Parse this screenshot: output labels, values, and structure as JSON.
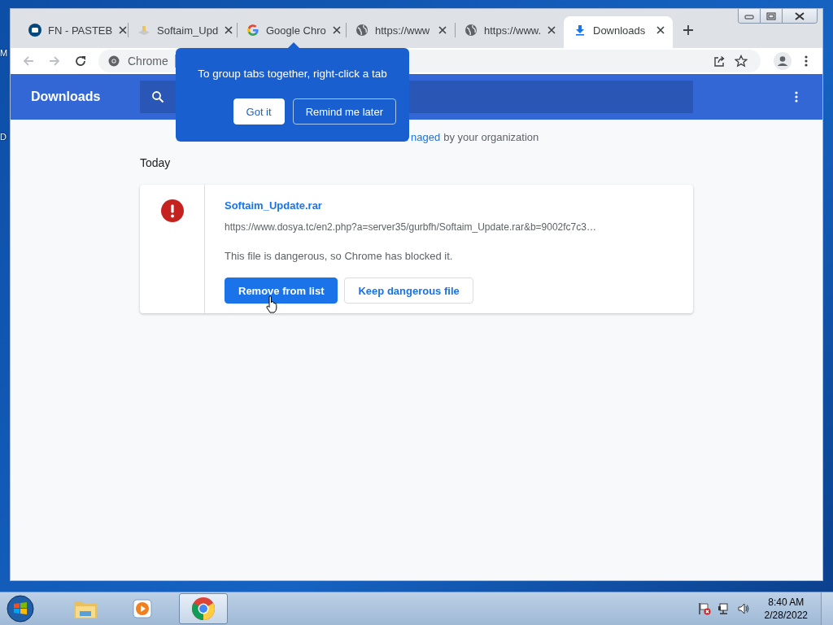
{
  "desktop_labels": [
    "M",
    "D"
  ],
  "tabs": [
    {
      "title": "FN - PASTEB",
      "kind": "pastebin",
      "selected": false
    },
    {
      "title": "Softaim_Upd",
      "kind": "file",
      "selected": false
    },
    {
      "title": "Google Chro",
      "kind": "google",
      "selected": false
    },
    {
      "title": "https://www",
      "kind": "globe",
      "selected": false
    },
    {
      "title": "https://www.",
      "kind": "globe",
      "selected": false
    },
    {
      "title": "Downloads",
      "kind": "download",
      "selected": true
    }
  ],
  "toolbar": {
    "site_chip": "Chrome"
  },
  "header": {
    "title": "Downloads"
  },
  "managed_notice": {
    "link": "naged",
    "text": "by your organization"
  },
  "section": "Today",
  "downloads": [
    {
      "file_name": "Softaim_Update.rar",
      "url": "https://www.dosya.tc/en2.php?a=server35/gurbfh/Softaim_Update.rar&b=9002fc7c3…",
      "warning": "This file is dangerous, so Chrome has blocked it.",
      "buttons": [
        {
          "label": "Remove from list",
          "primary": true
        },
        {
          "label": "Keep dangerous file",
          "primary": false
        }
      ]
    }
  ],
  "popup": {
    "message": "To group tabs together, right-click a tab",
    "buttons": [
      {
        "label": "Got it",
        "primary": true
      },
      {
        "label": "Remind me later",
        "primary": false
      }
    ]
  },
  "taskbar": {
    "apps": [
      {
        "kind": "explorer",
        "selected": false
      },
      {
        "kind": "media",
        "selected": false
      },
      {
        "kind": "chrome",
        "selected": true
      }
    ],
    "time": "8:40 AM",
    "date": "2/28/2022"
  }
}
